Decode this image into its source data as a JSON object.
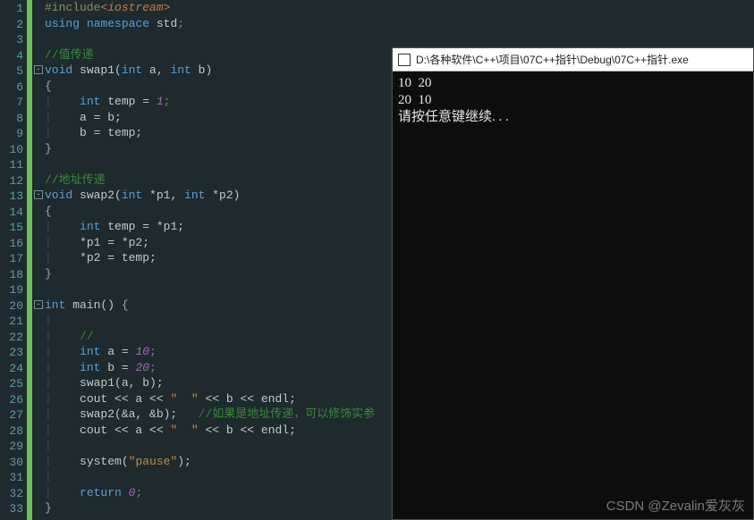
{
  "editor": {
    "lines_total": 33,
    "fold_markers": [
      5,
      13,
      20
    ],
    "code": {
      "l1_pre": "#include",
      "l1_inc": "<iostream>",
      "l2_kw1": "using",
      "l2_kw2": "namespace",
      "l2_id": "std",
      "l2_sc": ";",
      "l4_cm": "//值传递",
      "l5_kw": "void",
      "l5_fn": " swap1(",
      "l5_t1": "int",
      "l5_p1": " a, ",
      "l5_t2": "int",
      "l5_p2": " b)",
      "l6_open": "{",
      "l7_pad": "    ",
      "l7_kw": "int",
      "l7_rest": " temp = ",
      "l7_num": "1",
      "l7_sc": ";",
      "l8": "    a = b;",
      "l9": "    b = temp;",
      "l10_close": "}",
      "l12_cm": "//地址传递",
      "l13_kw": "void",
      "l13_fn": " swap2(",
      "l13_t1": "int",
      "l13_p1": " *p1, ",
      "l13_t2": "int",
      "l13_p2": " *p2)",
      "l14_open": "{",
      "l15_pad": "    ",
      "l15_kw": "int",
      "l15_rest": " temp = *p1;",
      "l16": "    *p1 = *p2;",
      "l17": "    *p2 = temp;",
      "l18_close": "}",
      "l20_kw": "int",
      "l20_fn": " main() ",
      "l20_brace": "{",
      "l22_cm": "    //",
      "l23_pad": "    ",
      "l23_kw": "int",
      "l23_rest": " a = ",
      "l23_num": "10",
      "l23_sc": ";",
      "l24_pad": "    ",
      "l24_kw": "int",
      "l24_rest": " b = ",
      "l24_num": "20",
      "l24_sc": ";",
      "l25": "    swap1(a, b);",
      "l26a": "    cout << a << ",
      "l26s": "\"  \"",
      "l26b": " << b << endl;",
      "l27a": "    swap2(&a, &b);",
      "l27cm": "   //如果是地址传递，可以修饰实参",
      "l28a": "    cout << a << ",
      "l28s": "\"  \"",
      "l28b": " << b << endl;",
      "l30a": "    system(",
      "l30s": "\"pause\"",
      "l30b": ");",
      "l32_pad": "    ",
      "l32_kw": "return",
      "l32_sp": " ",
      "l32_num": "0",
      "l32_sc": ";",
      "l33_close": "}"
    }
  },
  "console": {
    "title": "D:\\各种软件\\C++\\项目\\07C++指针\\Debug\\07C++指针.exe",
    "out1": "10  20",
    "out2": "20  10",
    "out3": "请按任意键继续. . ."
  },
  "watermark": "CSDN @Zevalin爱灰灰",
  "chart_data": null
}
